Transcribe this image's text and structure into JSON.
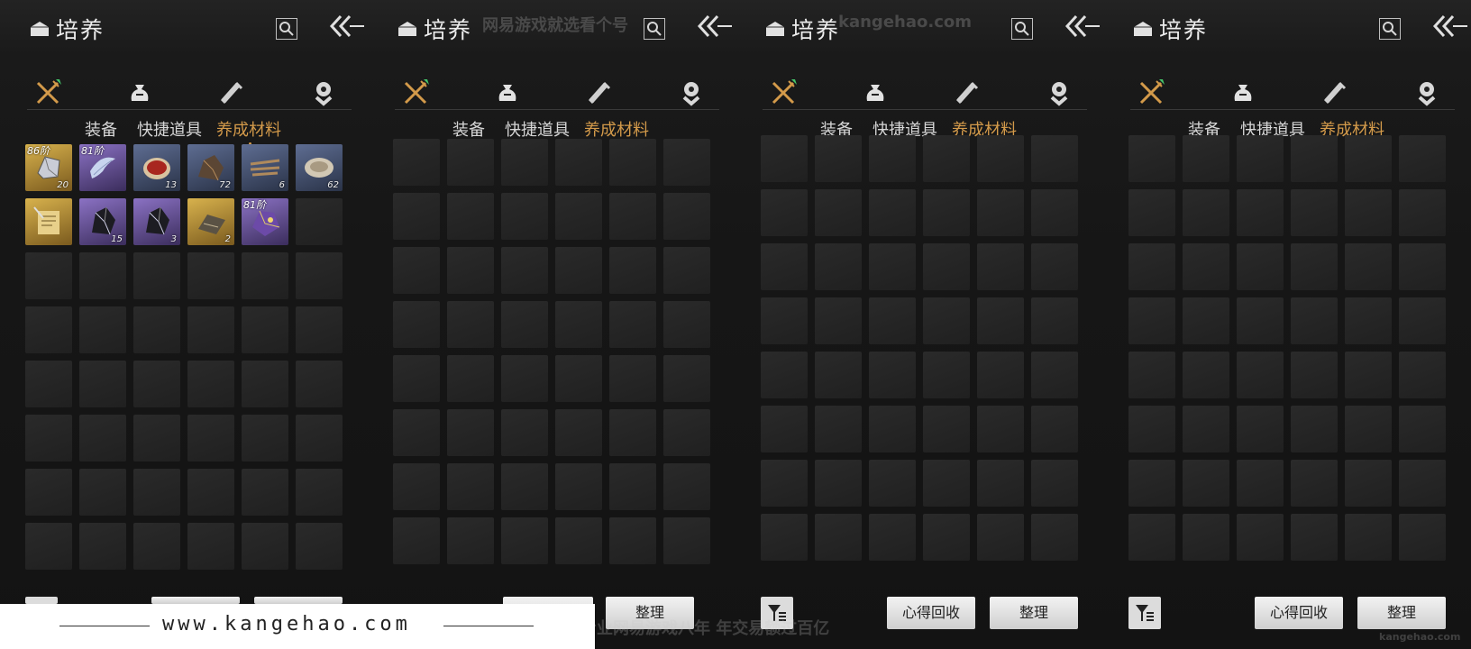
{
  "title": "培养",
  "tabs": [
    "装备",
    "快捷道具",
    "养成材料"
  ],
  "active_tab_index": 2,
  "category_icons": [
    "crossed-swords-icon",
    "pouch-icon",
    "scroll-icon",
    "gem-badge-icon"
  ],
  "items": [
    {
      "rarity": "gold",
      "icon": "ore-chunk-icon",
      "tier": "86阶",
      "count": "20"
    },
    {
      "rarity": "purple",
      "icon": "feather-icon",
      "tier": "81阶",
      "count": ""
    },
    {
      "rarity": "blue",
      "icon": "red-paste-icon",
      "tier": "",
      "count": "13"
    },
    {
      "rarity": "blue",
      "icon": "dark-ore-icon",
      "tier": "",
      "count": "72"
    },
    {
      "rarity": "blue",
      "icon": "twig-bundle-icon",
      "tier": "",
      "count": "6"
    },
    {
      "rarity": "blue",
      "icon": "stone-disc-icon",
      "tier": "",
      "count": "62"
    },
    {
      "rarity": "gold",
      "icon": "document-icon",
      "tier": "",
      "count": ""
    },
    {
      "rarity": "purple",
      "icon": "obsidian-icon",
      "tier": "",
      "count": "15"
    },
    {
      "rarity": "purple",
      "icon": "obsidian-icon",
      "tier": "",
      "count": "3"
    },
    {
      "rarity": "gold",
      "icon": "map-icon",
      "tier": "",
      "count": "2"
    },
    {
      "rarity": "purple",
      "icon": "crystal-icon",
      "tier": "81阶",
      "count": ""
    }
  ],
  "buttons": {
    "recycle": "心得回收",
    "recycle_partial": "收",
    "sort": "整理"
  },
  "footer": {
    "domain": "www.kangehao.com"
  },
  "watermarks": {
    "top": "网易游戏就选看个号",
    "top_url": "kangehao.com",
    "bottom": "看个号专业网易游戏八年 年交易额过百亿",
    "corner": "kangehao.com"
  },
  "colors": {
    "active_tab": "#d39a4a",
    "rarity_gold": "#d8b24d",
    "rarity_purple": "#8b72c4",
    "rarity_blue": "#5e6d92"
  }
}
